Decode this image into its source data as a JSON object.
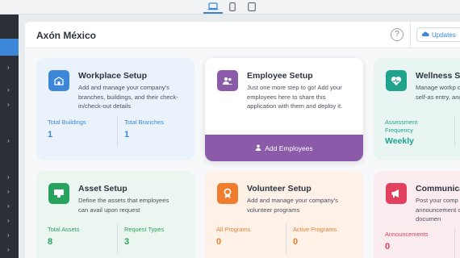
{
  "devices": [
    "laptop-icon",
    "phone-icon",
    "tablet-icon"
  ],
  "header": {
    "org_name": "Axón México",
    "help_label": "?",
    "updates_label": "Updates"
  },
  "colors": {
    "sidebar": "#2b3038",
    "accent": "#3d87d8",
    "employee_button": "#8b5aa8"
  },
  "cards": {
    "workplace": {
      "title": "Workplace Setup",
      "desc": "Add and manage your company's branches, buildings, and their check-in/check-out details",
      "stat1_label": "Total Buildings",
      "stat1_value": "1",
      "stat2_label": "Total Branches",
      "stat2_value": "1"
    },
    "employee": {
      "title": "Employee Setup",
      "desc": "Just one more step to go! Add your employees here to share this application with them and deploy it.",
      "button_label": "Add Employees"
    },
    "wellness": {
      "title": "Wellness Se",
      "desc": "Manage workp defining self-as entry, and trav",
      "stat1_label": "Assessment Frequency",
      "stat1_value": "Weekly"
    },
    "asset": {
      "title": "Asset Setup",
      "desc": "Define the assets that employees can avail upon request",
      "stat1_label": "Total Assets",
      "stat1_value": "8",
      "stat2_label": "Request Types",
      "stat2_value": "3"
    },
    "volunteer": {
      "title": "Volunteer Setup",
      "desc": "Add and manage your company's volunteer programs",
      "stat1_label": "All Programs",
      "stat1_value": "0",
      "stat2_label": "Active Programs",
      "stat2_value": "0"
    },
    "communication": {
      "title": "Communica",
      "desc": "Post your comp announcement other documen",
      "stat1_label": "Announcements",
      "stat1_value": "0"
    }
  }
}
